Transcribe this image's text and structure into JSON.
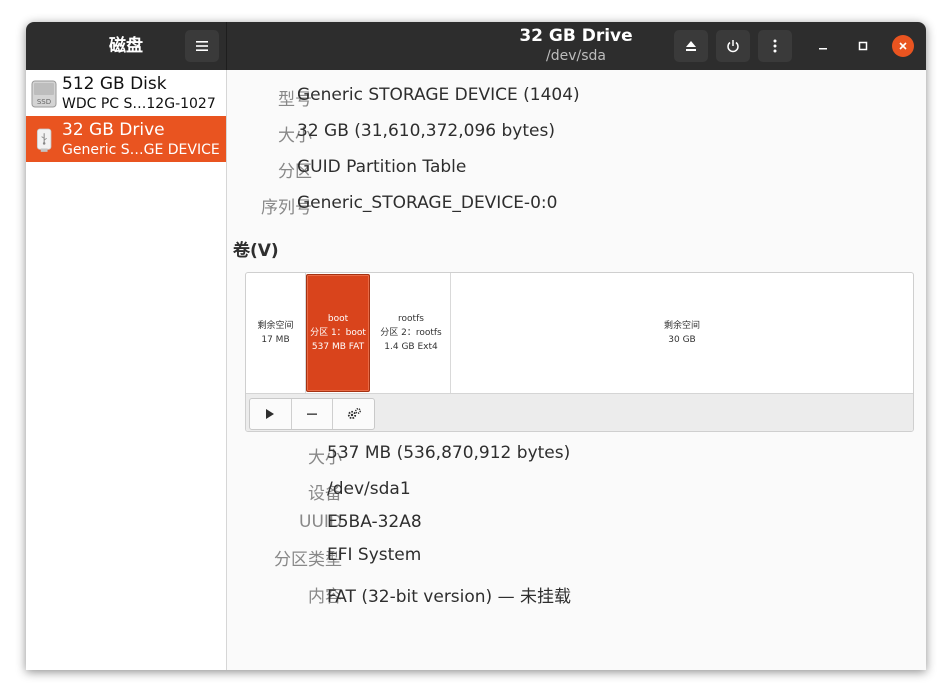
{
  "sidebar": {
    "title": "磁盘",
    "disks": [
      {
        "name": "512 GB Disk",
        "model": "WDC PC S…12G-1027",
        "icon": "ssd-icon",
        "icon_label": "SSD",
        "selected": false
      },
      {
        "name": "32 GB Drive",
        "model": "Generic S…GE DEVICE",
        "icon": "usb-drive-icon",
        "selected": true
      }
    ]
  },
  "header": {
    "title": "32 GB Drive",
    "subtitle": "/dev/sda"
  },
  "drive": {
    "model_label": "型号",
    "model": "Generic STORAGE DEVICE (1404)",
    "size_label": "大小",
    "size": "32 GB (31,610,372,096 bytes)",
    "partitioning_label": "分区",
    "partitioning": "GUID Partition Table",
    "serial_label": "序列号",
    "serial": "Generic_STORAGE_DEVICE-0:0"
  },
  "volumes": {
    "heading": "卷(V)",
    "segments": [
      {
        "line1": "剩余空间",
        "line2": "17 MB",
        "line3": ""
      },
      {
        "line1": "boot",
        "line2": "分区 1：boot",
        "line3": "537 MB FAT",
        "selected": true
      },
      {
        "line1": "rootfs",
        "line2": "分区 2：rootfs",
        "line3": "1.4 GB Ext4"
      },
      {
        "line1": "剩余空间",
        "line2": "30 GB",
        "line3": ""
      }
    ]
  },
  "selected": {
    "size_label": "大小",
    "size": "537 MB (536,870,912 bytes)",
    "device_label": "设备",
    "device": "/dev/sda1",
    "uuid_label": "UUID",
    "uuid": "E5BA-32A8",
    "type_label": "分区类型",
    "type": "EFI System",
    "contents_label": "内容",
    "contents": "FAT (32-bit version) — 未挂载"
  },
  "colors": {
    "accent": "#e95420",
    "titlebar": "#2d2d2d"
  }
}
